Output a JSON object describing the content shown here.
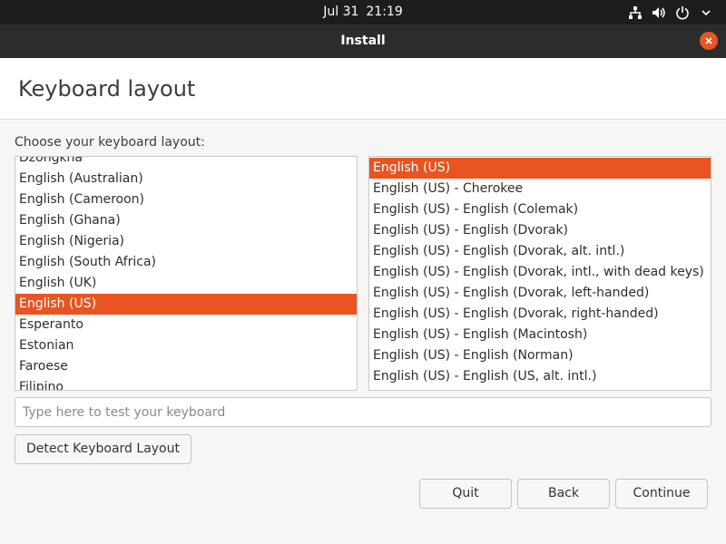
{
  "topbar": {
    "date": "Jul 31",
    "time": "21:19",
    "icons": [
      "network-icon",
      "volume-icon",
      "power-icon",
      "chevron-down-icon"
    ]
  },
  "window": {
    "title": "Install",
    "close_icon": "close-icon",
    "close_color": "#e95420"
  },
  "page": {
    "title": "Keyboard layout",
    "choose_label": "Choose your keyboard layout:"
  },
  "layouts": [
    "Dzongkha",
    "English (Australian)",
    "English (Cameroon)",
    "English (Ghana)",
    "English (Nigeria)",
    "English (South Africa)",
    "English (UK)",
    "English (US)",
    "Esperanto",
    "Estonian",
    "Faroese",
    "Filipino"
  ],
  "layouts_selected": "English (US)",
  "variants": [
    "English (US)",
    "English (US) - Cherokee",
    "English (US) - English (Colemak)",
    "English (US) - English (Dvorak)",
    "English (US) - English (Dvorak, alt. intl.)",
    "English (US) - English (Dvorak, intl., with dead keys)",
    "English (US) - English (Dvorak, left-handed)",
    "English (US) - English (Dvorak, right-handed)",
    "English (US) - English (Macintosh)",
    "English (US) - English (Norman)",
    "English (US) - English (US, alt. intl.)"
  ],
  "variants_selected": "English (US)",
  "test": {
    "placeholder": "Type here to test your keyboard",
    "value": ""
  },
  "buttons": {
    "detect": "Detect Keyboard Layout",
    "quit": "Quit",
    "back": "Back",
    "continue": "Continue"
  },
  "colors": {
    "accent": "#e95420",
    "topbar": "#1d1d1d",
    "titlebar": "#2c2c2c"
  }
}
